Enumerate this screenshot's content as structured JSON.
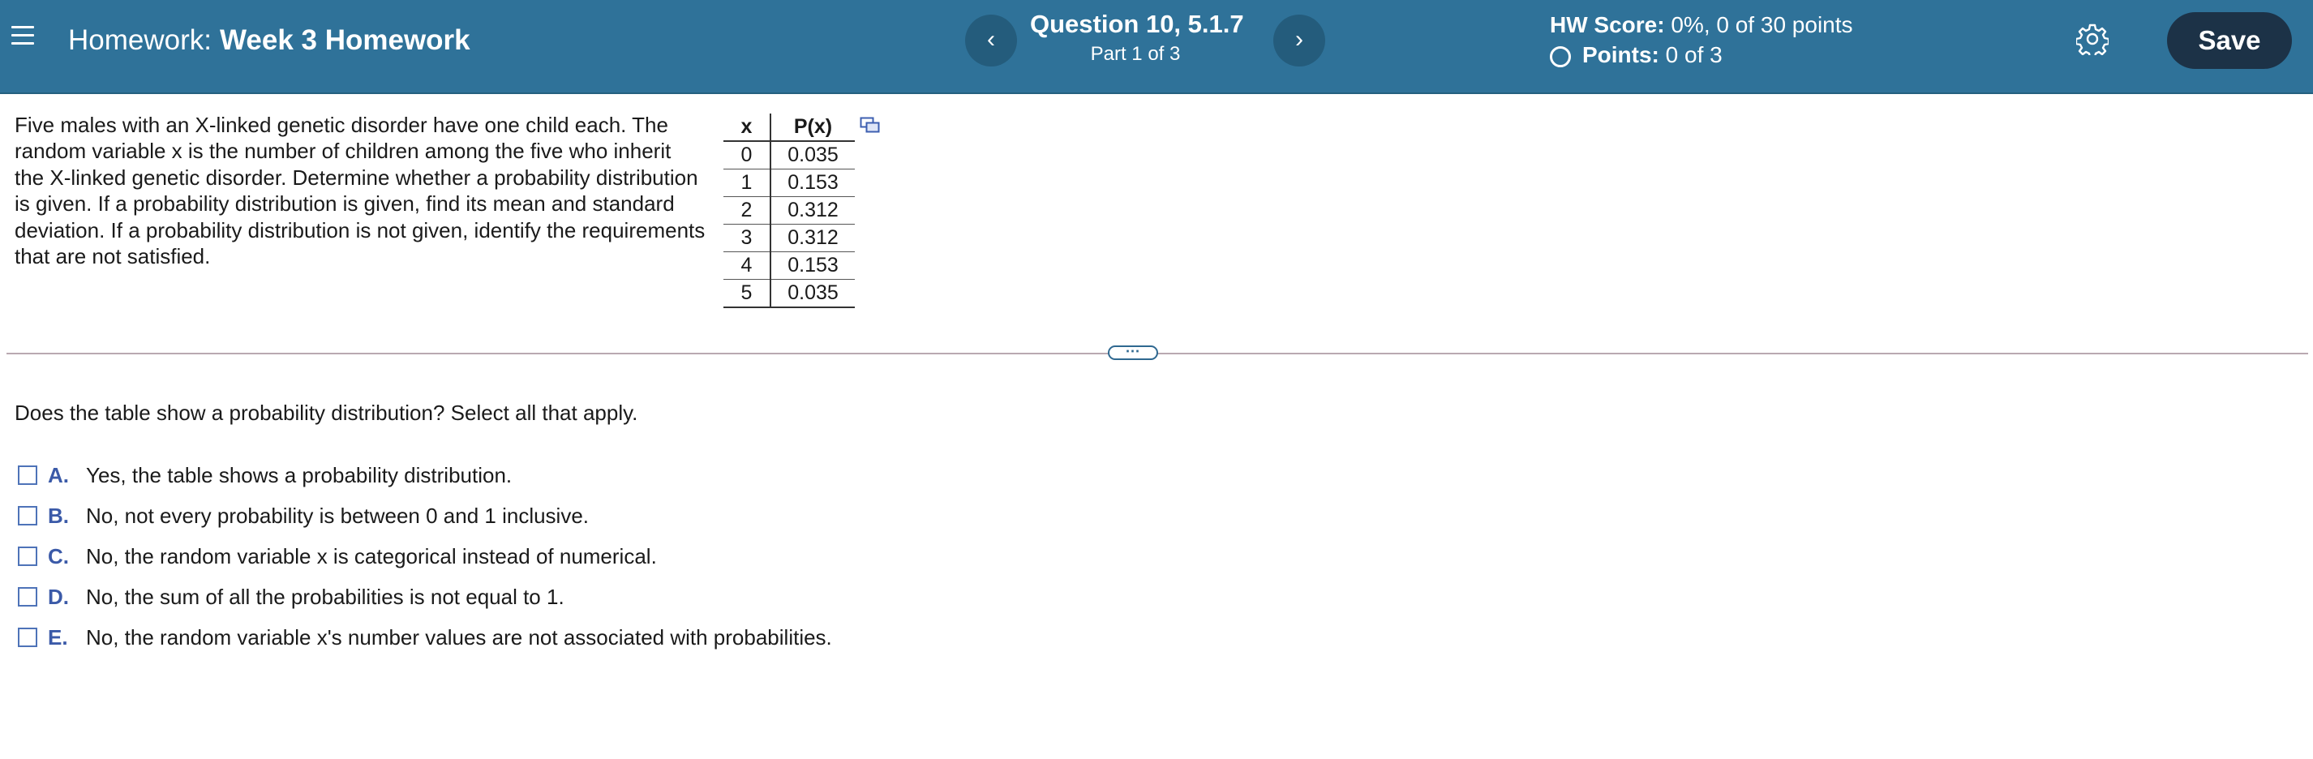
{
  "header": {
    "hw_label": "Homework:",
    "hw_name": "Week 3 Homework",
    "question_title": "Question 10, 5.1.7",
    "question_part": "Part 1 of 3",
    "prev_icon": "chevron-left-icon",
    "next_icon": "chevron-right-icon",
    "hw_score_label": "HW Score:",
    "hw_score_value": "0%, 0 of 30 points",
    "points_label": "Points:",
    "points_value": "0 of 3",
    "save_label": "Save",
    "colors": {
      "header_bg": "#2f7299",
      "save_bg": "#1c3247"
    }
  },
  "problem": {
    "text": "Five males with an X-linked genetic disorder have one child each. The\nrandom variable x is the number of children among the five who inherit\nthe X-linked genetic disorder. Determine whether a probability distribution\nis given. If a probability distribution is given, find its mean and standard\ndeviation. If a probability distribution is not given, identify the requirements\nthat are not satisfied.",
    "table": {
      "headers": [
        "x",
        "P(x)"
      ],
      "rows": [
        [
          "0",
          "0.035"
        ],
        [
          "1",
          "0.153"
        ],
        [
          "2",
          "0.312"
        ],
        [
          "3",
          "0.312"
        ],
        [
          "4",
          "0.153"
        ],
        [
          "5",
          "0.035"
        ]
      ]
    }
  },
  "question": {
    "prompt": "Does the table show a probability distribution? Select all that apply.",
    "options": [
      {
        "letter": "A.",
        "text": "Yes, the table shows a probability distribution.",
        "checked": false
      },
      {
        "letter": "B.",
        "text": "No, not every probability is between 0 and 1 inclusive.",
        "checked": false
      },
      {
        "letter": "C.",
        "text": "No, the random variable x is categorical instead of numerical.",
        "checked": false
      },
      {
        "letter": "D.",
        "text": "No, the sum of all the probabilities is not equal to 1.",
        "checked": false
      },
      {
        "letter": "E.",
        "text": "No, the random variable x's number values are not associated with probabilities.",
        "checked": false
      }
    ]
  }
}
